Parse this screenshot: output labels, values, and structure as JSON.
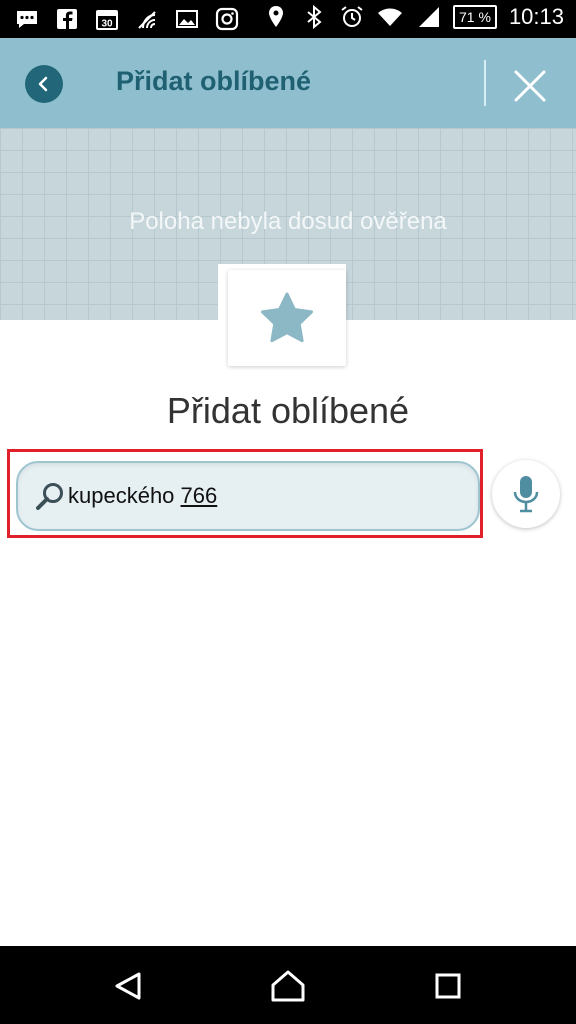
{
  "status_bar": {
    "left_icons": [
      "chat-icon",
      "facebook-icon",
      "calendar-icon",
      "nfc-icon",
      "gallery-icon",
      "instagram-icon"
    ],
    "calendar_day": "30",
    "right_icons": [
      "location-icon",
      "bluetooth-icon",
      "alarm-icon",
      "wifi-icon",
      "signal-icon"
    ],
    "battery": "71 %",
    "time": "10:13"
  },
  "app_bar": {
    "title": "Přidat oblíbené",
    "color": "#8fbfcf",
    "accent": "#1f6173"
  },
  "map": {
    "status_text": "Poloha nebyla dosud ověřena"
  },
  "main": {
    "heading": "Přidat oblíbené",
    "search": {
      "value_part1": "kupeckého ",
      "value_part2": "766"
    }
  },
  "nav_bar": {
    "buttons": [
      "back",
      "home",
      "recent-apps"
    ]
  }
}
